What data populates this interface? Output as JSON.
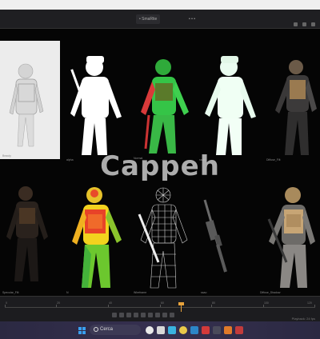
{
  "header": {
    "tab_left": "• SmaRtie",
    "tab_right": "• • •"
  },
  "tiles": [
    {
      "label": "Beauty",
      "kind": "clay"
    },
    {
      "label": "alpha",
      "kind": "alpha"
    },
    {
      "label": "Normal",
      "kind": "normal"
    },
    {
      "label": "ssao",
      "kind": "mint"
    },
    {
      "label": "Diffuse_Filt",
      "kind": "diffuse"
    },
    {
      "label": "Specular_Filt",
      "kind": "dark"
    },
    {
      "label": "N",
      "kind": "heat"
    },
    {
      "label": "Wireframe",
      "kind": "wire"
    },
    {
      "label": "ssao",
      "kind": "weapon"
    },
    {
      "label": "Diffuse_Shadow",
      "kind": "final"
    }
  ],
  "watermark": "Cappeh",
  "timeline": {
    "marks": [
      "0",
      "20",
      "40",
      "60",
      "80",
      "100",
      "120"
    ],
    "status": "Playback: 24 fps"
  },
  "taskbar": {
    "search_label": "Cerca"
  },
  "colors": {
    "accent": "#e8a33c",
    "background": "#050505"
  }
}
